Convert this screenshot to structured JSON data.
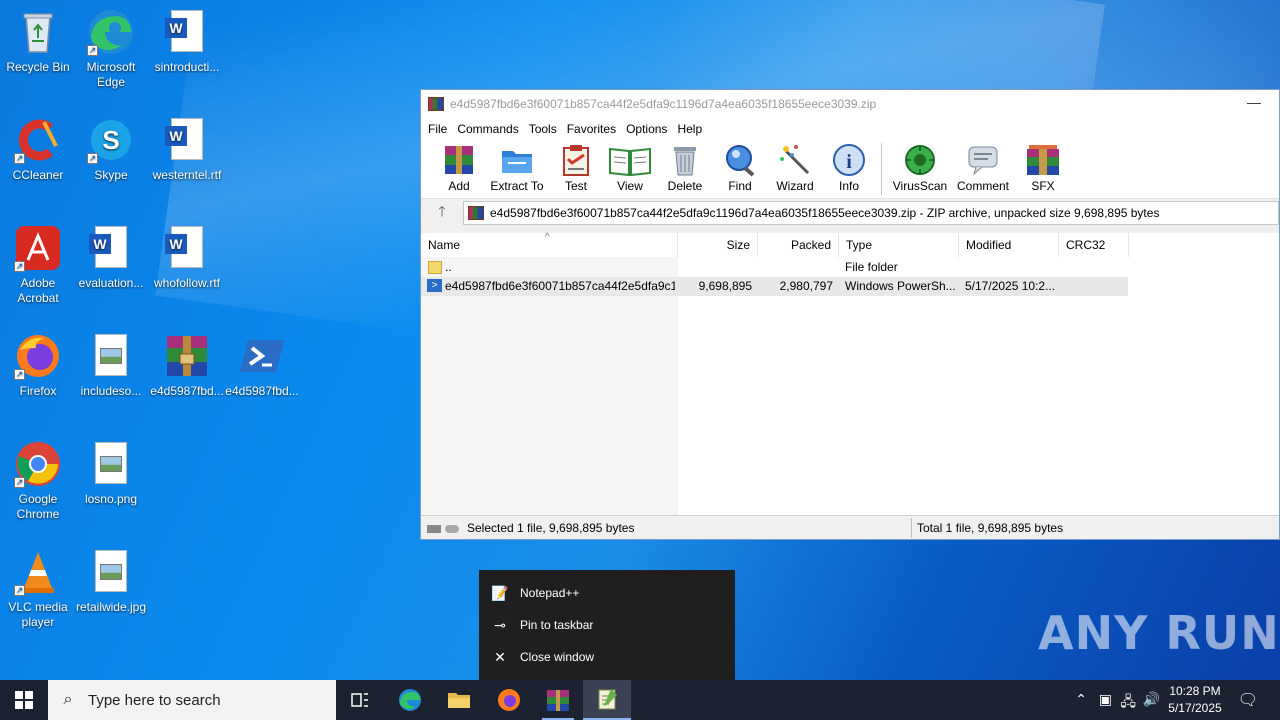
{
  "desktop": {
    "icons": [
      {
        "label": "Recycle Bin",
        "icon": "recycle-bin-icon"
      },
      {
        "label": "Microsoft Edge",
        "icon": "edge-icon"
      },
      {
        "label": "sintroducti...",
        "icon": "word-doc-icon"
      },
      {
        "label": "CCleaner",
        "icon": "ccleaner-icon"
      },
      {
        "label": "Skype",
        "icon": "skype-icon"
      },
      {
        "label": "westerntel.rtf",
        "icon": "word-doc-icon"
      },
      {
        "label": "Adobe Acrobat",
        "icon": "acrobat-icon"
      },
      {
        "label": "evaluation...",
        "icon": "word-doc-icon"
      },
      {
        "label": "whofollow.rtf",
        "icon": "word-doc-icon"
      },
      {
        "label": "Firefox",
        "icon": "firefox-icon"
      },
      {
        "label": "includeso...",
        "icon": "image-file-icon"
      },
      {
        "label": "e4d5987fbd...",
        "icon": "winrar-archive-icon"
      },
      {
        "label": "e4d5987fbd...",
        "icon": "powershell-icon"
      },
      {
        "label": "Google Chrome",
        "icon": "chrome-icon"
      },
      {
        "label": "losno.png",
        "icon": "image-file-icon"
      },
      {
        "label": "VLC media player",
        "icon": "vlc-icon"
      },
      {
        "label": "retailwide.jpg",
        "icon": "image-file-icon"
      }
    ]
  },
  "winrar": {
    "title": "e4d5987fbd6e3f60071b857ca44f2e5dfa9c1196d7a4ea6035f18655eece3039.zip",
    "menu": [
      "File",
      "Commands",
      "Tools",
      "Favorites",
      "Options",
      "Help"
    ],
    "toolbar": [
      {
        "label": "Add",
        "icon": "add-archive-icon"
      },
      {
        "label": "Extract To",
        "icon": "extract-folder-icon"
      },
      {
        "label": "Test",
        "icon": "test-clipboard-icon"
      },
      {
        "label": "View",
        "icon": "view-book-icon"
      },
      {
        "label": "Delete",
        "icon": "trash-icon"
      },
      {
        "label": "Find",
        "icon": "find-magnifier-icon"
      },
      {
        "label": "Wizard",
        "icon": "wizard-wand-icon"
      },
      {
        "label": "Info",
        "icon": "info-icon"
      },
      {
        "label": "VirusScan",
        "icon": "virus-scan-icon"
      },
      {
        "label": "Comment",
        "icon": "comment-icon"
      },
      {
        "label": "SFX",
        "icon": "sfx-icon"
      }
    ],
    "path": "e4d5987fbd6e3f60071b857ca44f2e5dfa9c1196d7a4ea6035f18655eece3039.zip - ZIP archive, unpacked size 9,698,895 bytes",
    "columns": [
      "Name",
      "Size",
      "Packed",
      "Type",
      "Modified",
      "CRC32"
    ],
    "rows": [
      {
        "name": "..",
        "size": "",
        "packed": "",
        "type": "File folder",
        "modified": "",
        "crc": ""
      },
      {
        "name": "e4d5987fbd6e3f60071b857ca44f2e5dfa9c1...",
        "size": "9,698,895",
        "packed": "2,980,797",
        "type": "Windows PowerSh...",
        "modified": "5/17/2025 10:2...",
        "crc": ""
      }
    ],
    "status_left": "Selected 1 file, 9,698,895 bytes",
    "status_right": "Total 1 file, 9,698,895 bytes"
  },
  "jumplist": {
    "items": [
      {
        "label": "Notepad++",
        "icon": "notepadpp-icon"
      },
      {
        "label": "Pin to taskbar",
        "icon": "pin-icon"
      },
      {
        "label": "Close window",
        "icon": "close-icon"
      }
    ]
  },
  "taskbar": {
    "search_placeholder": "Type here to search",
    "time": "10:28 PM",
    "date": "5/17/2025"
  },
  "watermark": "ANY RUN"
}
